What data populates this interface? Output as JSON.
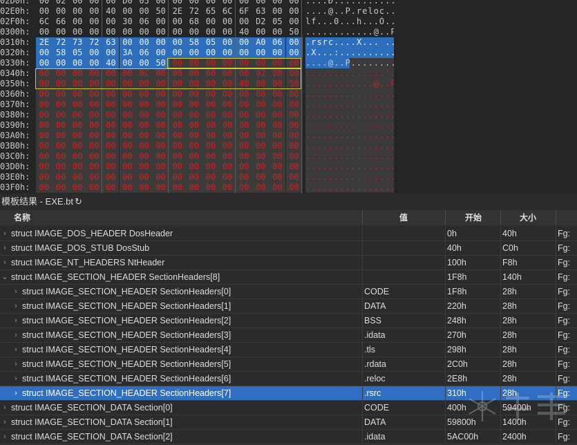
{
  "hex": {
    "rows": [
      {
        "addr": "02D0h:",
        "bytes": [
          "00",
          "02",
          "00",
          "00",
          "00",
          "D0",
          "05",
          "00",
          "00",
          "00",
          "00",
          "00",
          "00",
          "00",
          "00",
          "00"
        ],
        "ascii": "....Ð..........."
      },
      {
        "addr": "02E0h:",
        "bytes": [
          "00",
          "00",
          "00",
          "00",
          "40",
          "00",
          "00",
          "50",
          "2E",
          "72",
          "65",
          "6C",
          "6F",
          "63",
          "00",
          "00"
        ],
        "ascii": "....@..P.reloc.."
      },
      {
        "addr": "02F0h:",
        "bytes": [
          "6C",
          "66",
          "00",
          "00",
          "00",
          "30",
          "06",
          "00",
          "00",
          "68",
          "00",
          "00",
          "00",
          "D2",
          "05",
          "00"
        ],
        "ascii": "lf...0...h...Ò.."
      },
      {
        "addr": "0300h:",
        "bytes": [
          "00",
          "00",
          "00",
          "00",
          "00",
          "00",
          "00",
          "00",
          "00",
          "00",
          "00",
          "00",
          "40",
          "00",
          "00",
          "50"
        ],
        "ascii": "............@..P"
      },
      {
        "addr": "0310h:",
        "bytes": [
          "2E",
          "72",
          "73",
          "72",
          "63",
          "00",
          "00",
          "00",
          "00",
          "58",
          "05",
          "00",
          "00",
          "A0",
          "06",
          "00"
        ],
        "ascii": ".rsrc....X... .."
      },
      {
        "addr": "0320h:",
        "bytes": [
          "00",
          "58",
          "05",
          "00",
          "00",
          "3A",
          "06",
          "00",
          "00",
          "00",
          "00",
          "00",
          "00",
          "00",
          "00",
          "00"
        ],
        "ascii": ".X...:.........."
      },
      {
        "addr": "0330h:",
        "bytes": [
          "00",
          "00",
          "00",
          "00",
          "40",
          "00",
          "00",
          "50",
          "00",
          "00",
          "00",
          "00",
          "00",
          "00",
          "00",
          "00"
        ],
        "ascii": "....@..P........"
      },
      {
        "addr": "0340h:",
        "bytes": [
          "00",
          "00",
          "00",
          "00",
          "00",
          "00",
          "0C",
          "00",
          "00",
          "00",
          "00",
          "00",
          "00",
          "92",
          "0B",
          "00"
        ],
        "ascii": "..............'.."
      },
      {
        "addr": "0350h:",
        "bytes": [
          "00",
          "00",
          "00",
          "00",
          "00",
          "00",
          "00",
          "00",
          "00",
          "00",
          "00",
          "00",
          "40",
          "00",
          "00",
          "50"
        ],
        "ascii": "............@..P"
      },
      {
        "addr": "0360h:",
        "bytes": [
          "00",
          "00",
          "00",
          "00",
          "00",
          "00",
          "00",
          "00",
          "00",
          "00",
          "00",
          "00",
          "00",
          "00",
          "00",
          "00"
        ],
        "ascii": "................"
      },
      {
        "addr": "0370h:",
        "bytes": [
          "00",
          "00",
          "00",
          "00",
          "00",
          "00",
          "00",
          "00",
          "00",
          "00",
          "00",
          "00",
          "00",
          "00",
          "00",
          "00"
        ],
        "ascii": "................"
      },
      {
        "addr": "0380h:",
        "bytes": [
          "00",
          "00",
          "00",
          "00",
          "00",
          "00",
          "00",
          "00",
          "00",
          "00",
          "00",
          "00",
          "00",
          "00",
          "00",
          "00"
        ],
        "ascii": "................"
      },
      {
        "addr": "0390h:",
        "bytes": [
          "00",
          "00",
          "00",
          "00",
          "00",
          "00",
          "00",
          "00",
          "00",
          "00",
          "00",
          "00",
          "00",
          "00",
          "00",
          "00"
        ],
        "ascii": "................"
      },
      {
        "addr": "03A0h:",
        "bytes": [
          "00",
          "00",
          "00",
          "00",
          "00",
          "00",
          "00",
          "00",
          "00",
          "00",
          "00",
          "00",
          "00",
          "00",
          "00",
          "00"
        ],
        "ascii": "................"
      },
      {
        "addr": "03B0h:",
        "bytes": [
          "00",
          "00",
          "00",
          "00",
          "00",
          "00",
          "00",
          "00",
          "00",
          "00",
          "00",
          "00",
          "00",
          "00",
          "00",
          "00"
        ],
        "ascii": "................"
      },
      {
        "addr": "03C0h:",
        "bytes": [
          "00",
          "00",
          "00",
          "00",
          "00",
          "00",
          "00",
          "00",
          "00",
          "00",
          "00",
          "00",
          "00",
          "00",
          "00",
          "00"
        ],
        "ascii": "................"
      },
      {
        "addr": "03D0h:",
        "bytes": [
          "00",
          "00",
          "00",
          "00",
          "00",
          "00",
          "00",
          "00",
          "00",
          "00",
          "00",
          "00",
          "00",
          "00",
          "00",
          "00"
        ],
        "ascii": "................"
      },
      {
        "addr": "03E0h:",
        "bytes": [
          "00",
          "00",
          "00",
          "00",
          "00",
          "00",
          "00",
          "00",
          "00",
          "00",
          "00",
          "00",
          "00",
          "00",
          "00",
          "00"
        ],
        "ascii": "................"
      },
      {
        "addr": "03F0h:",
        "bytes": [
          "00",
          "00",
          "00",
          "00",
          "00",
          "00",
          "00",
          "00",
          "00",
          "00",
          "00",
          "00",
          "00",
          "00",
          "00",
          "00"
        ],
        "ascii": "................"
      }
    ],
    "colors": {
      "selected": "#2e6fbd",
      "unused_text": "#d41f1f",
      "highlight_border": "#d7c935"
    }
  },
  "template_results": {
    "title": "模板结果 - EXE.bt",
    "refresh_icon": "refresh-icon",
    "columns": {
      "name": "名称",
      "value": "值",
      "start": "开始",
      "size": "大小"
    },
    "rows": [
      {
        "indent": 0,
        "expanded": false,
        "name": "struct IMAGE_DOS_HEADER DosHeader",
        "value": "",
        "start": "0h",
        "size": "40h",
        "fg": "Fg:"
      },
      {
        "indent": 0,
        "expanded": false,
        "name": "struct IMAGE_DOS_STUB DosStub",
        "value": "",
        "start": "40h",
        "size": "C0h",
        "fg": "Fg:"
      },
      {
        "indent": 0,
        "expanded": false,
        "name": "struct IMAGE_NT_HEADERS NtHeader",
        "value": "",
        "start": "100h",
        "size": "F8h",
        "fg": "Fg:"
      },
      {
        "indent": 0,
        "expanded": true,
        "name": "struct IMAGE_SECTION_HEADER SectionHeaders[8]",
        "value": "",
        "start": "1F8h",
        "size": "140h",
        "fg": "Fg:"
      },
      {
        "indent": 1,
        "expanded": false,
        "name": "struct IMAGE_SECTION_HEADER SectionHeaders[0]",
        "value": "CODE",
        "start": "1F8h",
        "size": "28h",
        "fg": "Fg:"
      },
      {
        "indent": 1,
        "expanded": false,
        "name": "struct IMAGE_SECTION_HEADER SectionHeaders[1]",
        "value": "DATA",
        "start": "220h",
        "size": "28h",
        "fg": "Fg:"
      },
      {
        "indent": 1,
        "expanded": false,
        "name": "struct IMAGE_SECTION_HEADER SectionHeaders[2]",
        "value": "BSS",
        "start": "248h",
        "size": "28h",
        "fg": "Fg:"
      },
      {
        "indent": 1,
        "expanded": false,
        "name": "struct IMAGE_SECTION_HEADER SectionHeaders[3]",
        "value": ".idata",
        "start": "270h",
        "size": "28h",
        "fg": "Fg:"
      },
      {
        "indent": 1,
        "expanded": false,
        "name": "struct IMAGE_SECTION_HEADER SectionHeaders[4]",
        "value": ".tls",
        "start": "298h",
        "size": "28h",
        "fg": "Fg:"
      },
      {
        "indent": 1,
        "expanded": false,
        "name": "struct IMAGE_SECTION_HEADER SectionHeaders[5]",
        "value": ".rdata",
        "start": "2C0h",
        "size": "28h",
        "fg": "Fg:"
      },
      {
        "indent": 1,
        "expanded": false,
        "name": "struct IMAGE_SECTION_HEADER SectionHeaders[6]",
        "value": ".reloc",
        "start": "2E8h",
        "size": "28h",
        "fg": "Fg:"
      },
      {
        "indent": 1,
        "expanded": false,
        "selected": true,
        "name": "struct IMAGE_SECTION_HEADER SectionHeaders[7]",
        "value": ".rsrc",
        "start": "310h",
        "size": "28h",
        "fg": "Fg:"
      },
      {
        "indent": 0,
        "expanded": false,
        "name": "struct IMAGE_SECTION_DATA Section[0]",
        "value": "CODE",
        "start": "400h",
        "size": "59400h",
        "fg": "Fg:"
      },
      {
        "indent": 0,
        "expanded": false,
        "name": "struct IMAGE_SECTION_DATA Section[1]",
        "value": "DATA",
        "start": "59800h",
        "size": "1400h",
        "fg": "Fg:"
      },
      {
        "indent": 0,
        "expanded": false,
        "name": "struct IMAGE_SECTION_DATA Section[2]",
        "value": ".idata",
        "start": "5AC00h",
        "size": "2400h",
        "fg": "Fg:"
      }
    ],
    "colors": {
      "selected_row": "#2f6ec2"
    }
  }
}
